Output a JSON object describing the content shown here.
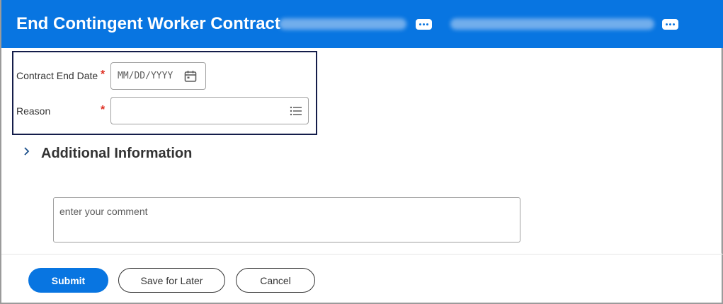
{
  "header": {
    "title": "End Contingent Worker Contract",
    "related_actions_1": "related-actions",
    "related_actions_2": "related-actions"
  },
  "form": {
    "contract_end_date": {
      "label": "Contract End Date",
      "required_mark": "*",
      "placeholder": "MM/DD/YYYY",
      "icon": "calendar-icon"
    },
    "reason": {
      "label": "Reason",
      "required_mark": "*",
      "icon": "list-prompt-icon"
    }
  },
  "additional_info": {
    "title": "Additional Information",
    "icon": "chevron-right-icon"
  },
  "comment": {
    "placeholder": "enter your comment",
    "value": ""
  },
  "actions": {
    "submit": "Submit",
    "save_for_later": "Save for Later",
    "cancel": "Cancel"
  },
  "colors": {
    "header_bg": "#0875e1",
    "primary_button": "#0875e1",
    "required": "#de2e21",
    "highlight_border": "#141d4a"
  }
}
